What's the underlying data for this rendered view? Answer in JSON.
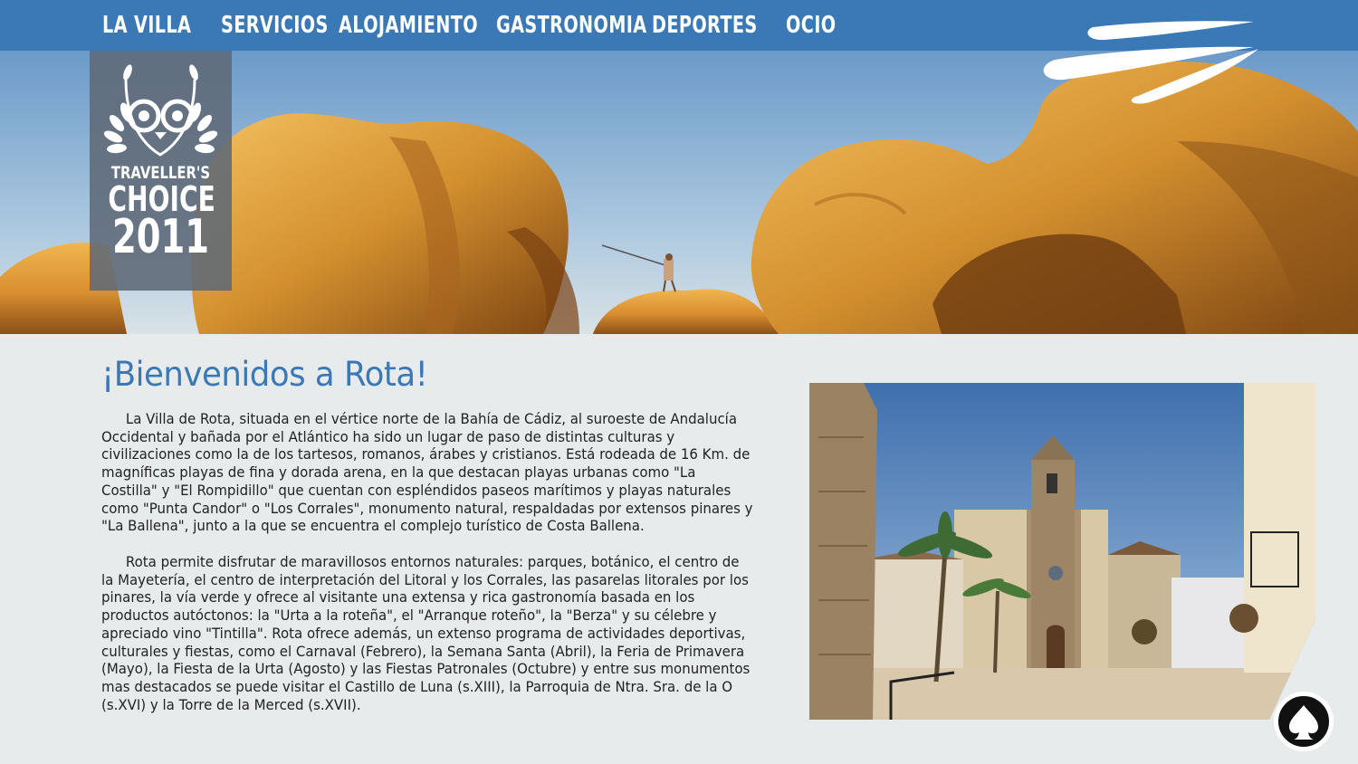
{
  "nav": {
    "items": [
      {
        "label": "LA VILLA"
      },
      {
        "label": "SERVICIOS"
      },
      {
        "label": "ALOJAMIENTO"
      },
      {
        "label": "GASTRONOMIA"
      },
      {
        "label": "DEPORTES"
      },
      {
        "label": "OCIO"
      }
    ]
  },
  "badge": {
    "line1": "TRAVELLER'S",
    "line2": "CHOICE",
    "line3": "2011",
    "icon": "owl-laurel-icon"
  },
  "logo": {
    "icon": "swoosh-logo-icon"
  },
  "content": {
    "title": "¡Bienvenidos a Rota!",
    "paragraphs": [
      "La Villa de Rota, situada en el vértice norte de la Bahía de Cádiz, al suroeste de Andalucía Occidental y bañada por el Atlántico ha sido un lugar de paso de distintas culturas y civilizaciones como la de los tartesos, romanos, árabes y cristianos. Está rodeada de 16 Km. de magníficas playas de fina y dorada arena, en la que destacan playas urbanas como \"La Costilla\" y \"El Rompidillo\" que cuentan con espléndidos paseos marítimos y playas naturales como \"Punta Candor\" o \"Los Corrales\", monumento natural, respaldadas por extensos pinares y \"La Ballena\", junto a la que se encuentra el complejo turístico de Costa Ballena.",
      "Rota permite disfrutar de maravillosos entornos naturales: parques, botánico, el centro de la Mayetería, el centro de interpretación del Litoral y los Corrales, las pasarelas litorales por los pinares, la vía verde y ofrece al visitante una extensa y rica gastronomía basada en los productos autóctonos: la \"Urta a la roteña\", el \"Arranque roteño\", la \"Berza\" y su célebre y apreciado vino \"Tintilla\". Rota ofrece además, un extenso programa de actividades deportivas, culturales y fiestas, como el Carnaval (Febrero), la Semana Santa (Abril), la Feria de Primavera (Mayo), la Fiesta de la Urta (Agosto) y las Fiestas Patronales (Octubre) y entre sus monumentos mas destacados se puede visitar el Castillo de Luna (s.XIII), la Parroquia de Ntra. Sra. de la O (s.XVI) y la Torre de la Merced (s.XVII)."
    ]
  },
  "photo": {
    "icon": "church-plaza-photo"
  },
  "round_logo": {
    "icon": "spade-logo-icon"
  },
  "colors": {
    "nav_bg": "#3a78b6",
    "title": "#3a78b6",
    "page_bg": "#e8ebec",
    "badge_bg": "#5f6976"
  }
}
